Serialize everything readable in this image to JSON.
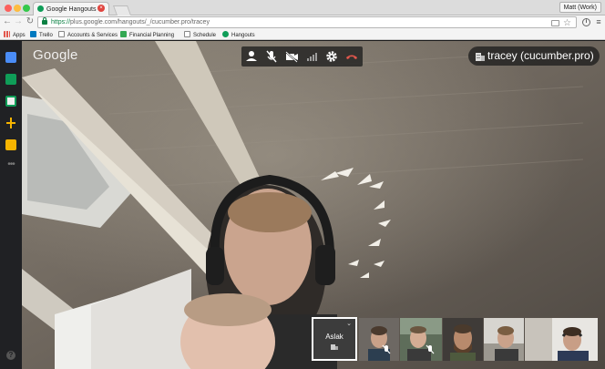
{
  "browser": {
    "tab_title": "Google Hangouts",
    "profile_name": "Matt (Work)",
    "url_scheme": "https://",
    "url_rest": "plus.google.com/hangouts/_/cucumber.pro/tracey",
    "bookmarks": [
      {
        "label": "Apps",
        "icon": "apps-grid-icon"
      },
      {
        "label": "Trello",
        "icon": "trello-icon"
      },
      {
        "label": "Accounts & Services",
        "icon": "document-icon"
      },
      {
        "label": "Financial Planning",
        "icon": "spreadsheet-icon"
      },
      {
        "label": "Schedule",
        "icon": "document-icon"
      },
      {
        "label": "Hangouts",
        "icon": "hangouts-icon"
      }
    ]
  },
  "hangout": {
    "logo_text": "Google",
    "owner_label": "tracey (cucumber.pro)",
    "controls": [
      {
        "name": "invite-people-icon",
        "color": "#ffffff"
      },
      {
        "name": "microphone-muted-icon",
        "color": "#ffffff"
      },
      {
        "name": "camera-off-icon",
        "color": "#ffffff"
      },
      {
        "name": "bandwidth-signal-icon",
        "color": "#9e9e9e"
      },
      {
        "name": "settings-gear-icon",
        "color": "#ffffff"
      },
      {
        "name": "hang-up-icon",
        "color": "#e2574c"
      }
    ],
    "self_tile": {
      "name": "Aslak"
    },
    "participants": [
      {
        "name": "participant-1",
        "muted": true
      },
      {
        "name": "participant-2",
        "muted": true
      },
      {
        "name": "participant-3",
        "muted": false
      },
      {
        "name": "participant-4",
        "muted": false
      },
      {
        "name": "participant-5",
        "muted": false
      }
    ]
  },
  "colors": {
    "accent": "#4a8cf6",
    "hangup": "#e2574c",
    "ssl_green": "#0b8043"
  }
}
